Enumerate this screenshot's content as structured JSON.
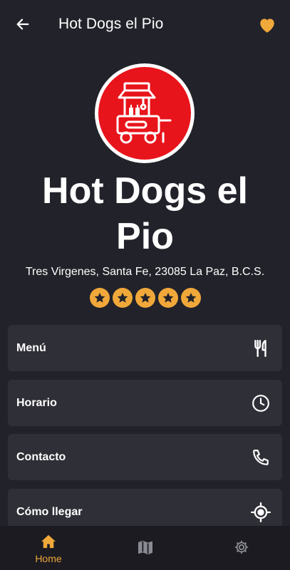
{
  "appbar": {
    "title": "Hot Dogs el Pio",
    "back_icon": "arrow-left-icon",
    "favorite_icon": "heart-icon"
  },
  "place": {
    "logo_icon": "hot-dog-cart-icon",
    "name": "Hot Dogs el Pio",
    "address": "Tres Virgenes, Santa Fe, 23085 La Paz, B.C.S.",
    "rating": 5,
    "rating_max": 5
  },
  "menu_items": [
    {
      "label": "Menú",
      "icon": "fork-knife-icon"
    },
    {
      "label": "Horario",
      "icon": "clock-icon"
    },
    {
      "label": "Contacto",
      "icon": "phone-icon"
    },
    {
      "label": "Cómo llegar",
      "icon": "crosshair-icon"
    }
  ],
  "bottom_nav": {
    "items": [
      {
        "label": "Home",
        "icon": "home-icon",
        "active": true
      },
      {
        "label": "",
        "icon": "map-icon",
        "active": false
      },
      {
        "label": "",
        "icon": "settings-icon",
        "active": false
      }
    ]
  },
  "colors": {
    "background": "#22222a",
    "card": "#2f2f37",
    "accent": "#f0a83a",
    "logo_red": "#e8141b",
    "nav_background": "#1b1b21"
  }
}
